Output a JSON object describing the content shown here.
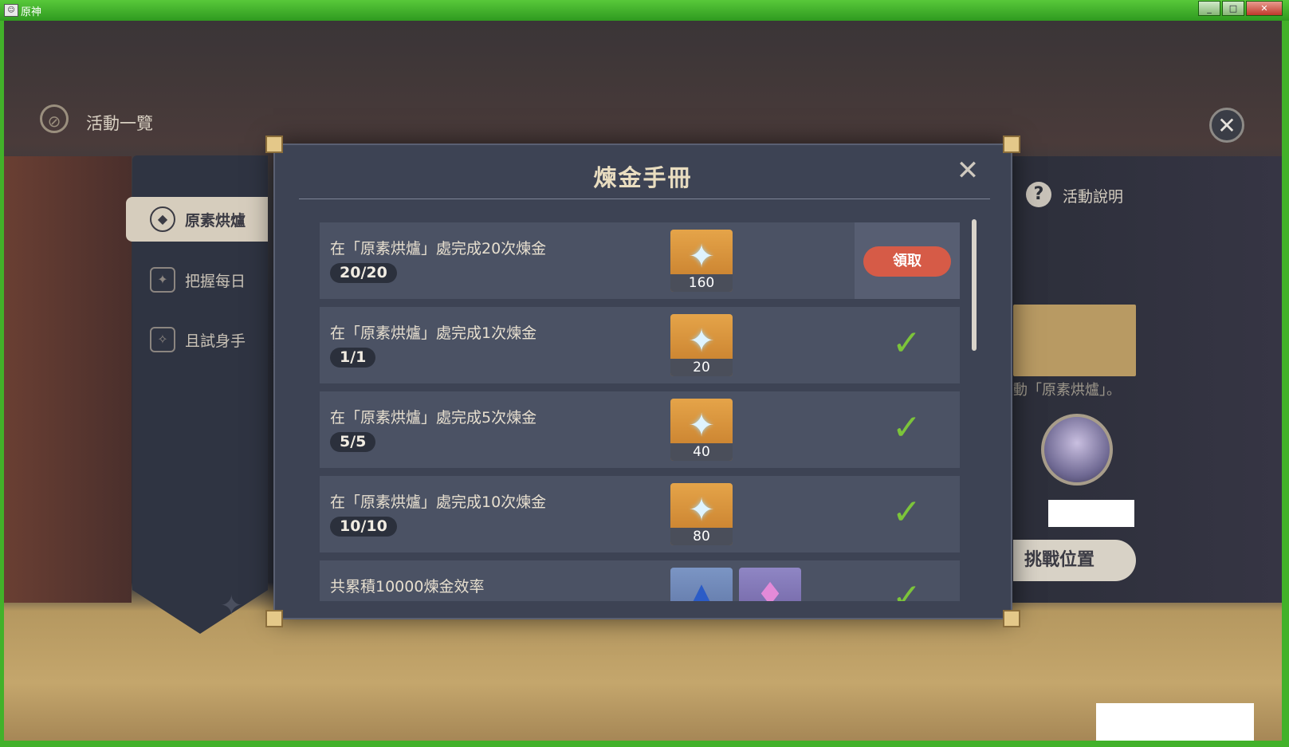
{
  "window": {
    "title": "原神",
    "minimize": "_",
    "maximize": "□",
    "close": "✕"
  },
  "header": {
    "title": "活動一覽",
    "compass_icon": "⊘",
    "close_icon": "✕"
  },
  "sidebar": {
    "items": [
      {
        "label": "原素烘爐",
        "icon": "◆",
        "active": true
      },
      {
        "label": "把握每日",
        "icon": "✦",
        "active": false
      },
      {
        "label": "且試身手",
        "icon": "✧",
        "active": false
      }
    ]
  },
  "right_panel": {
    "help_icon": "?",
    "help_label": "活動說明",
    "description_fragment": "動「原素烘爐」。",
    "challenge_button": "挑戰位置"
  },
  "modal": {
    "title": "煉金手冊",
    "close_icon": "✕",
    "claim_label": "領取",
    "tasks": [
      {
        "desc": "在「原素烘爐」處完成20次煉金",
        "progress": "20/20",
        "reward_qty": "160",
        "status": "claimable"
      },
      {
        "desc": "在「原素烘爐」處完成1次煉金",
        "progress": "1/1",
        "reward_qty": "20",
        "status": "claimed"
      },
      {
        "desc": "在「原素烘爐」處完成5次煉金",
        "progress": "5/5",
        "reward_qty": "40",
        "status": "claimed"
      },
      {
        "desc": "在「原素烘爐」處完成10次煉金",
        "progress": "10/10",
        "reward_qty": "80",
        "status": "claimed"
      },
      {
        "desc": "共累積10000煉金效率",
        "progress": "",
        "reward_qty": "",
        "status": "claimed"
      }
    ]
  },
  "colors": {
    "accent_gold": "#e4c889",
    "claim_red": "#d65b47",
    "check_green": "#7cc43a"
  }
}
